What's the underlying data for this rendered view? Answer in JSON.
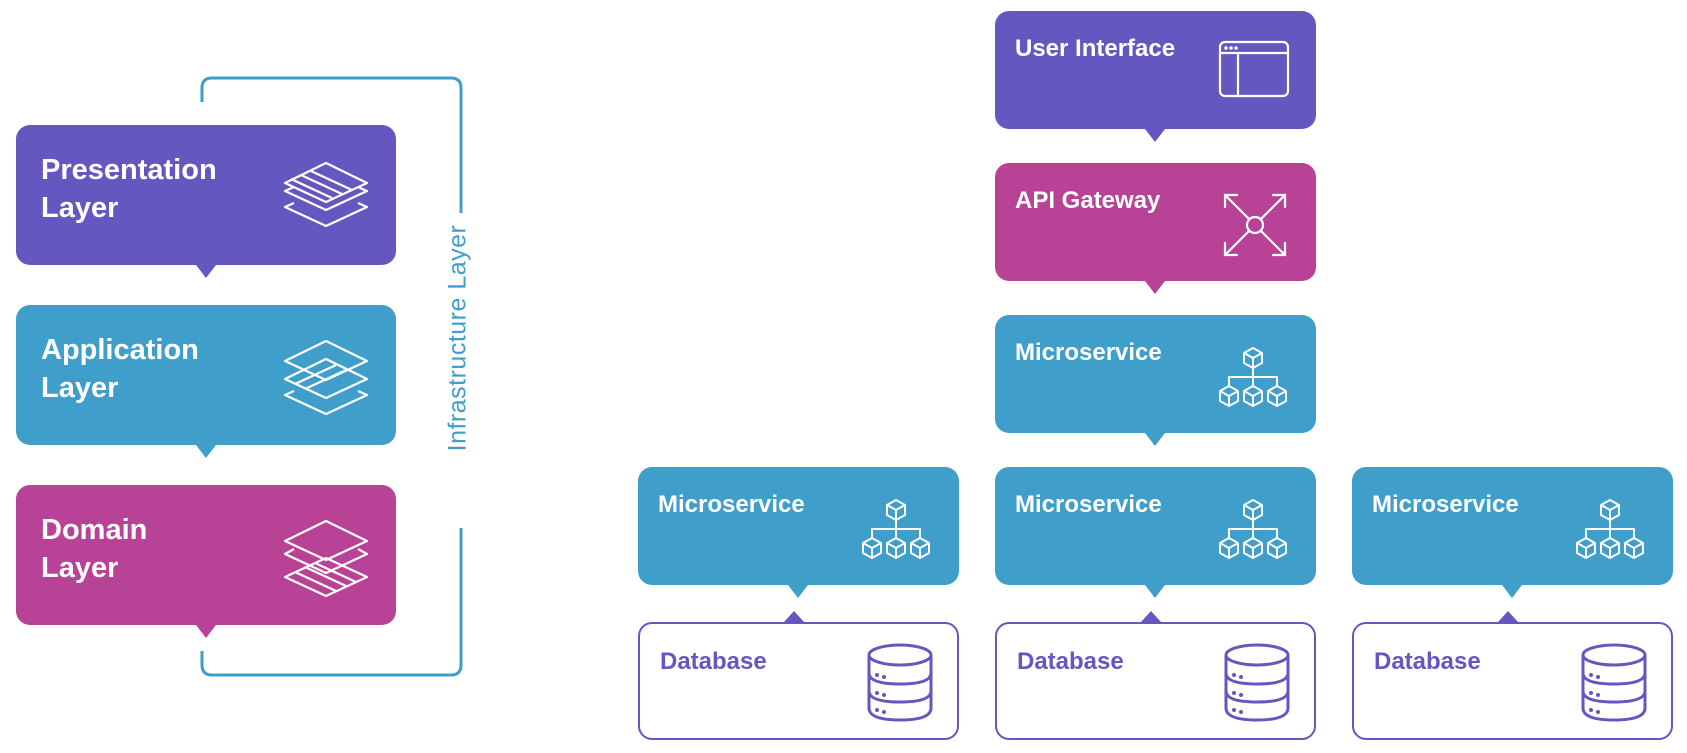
{
  "colors": {
    "presentation": "#6457c0",
    "application": "#3f9fca",
    "domain": "#b84396",
    "infrastructure": "#3f9fca",
    "user_interface": "#6457c0",
    "api_gateway": "#b84396",
    "microservice": "#3f9fca",
    "database_border": "#6457c0"
  },
  "layered": {
    "layers": [
      {
        "label": "Presentation Layer",
        "line1": "Presentation",
        "line2": "Layer",
        "icon": "layers-top-highlight-icon"
      },
      {
        "label": "Application Layer",
        "line1": "Application",
        "line2": "Layer",
        "icon": "layers-middle-highlight-icon"
      },
      {
        "label": "Domain Layer",
        "line1": "Domain",
        "line2": "Layer",
        "icon": "layers-bottom-highlight-icon"
      }
    ],
    "infrastructure_label": "Infrastructure Layer"
  },
  "microservices_arch": {
    "user_interface": {
      "label": "User Interface",
      "icon": "browser-window-icon"
    },
    "api_gateway": {
      "label": "API Gateway",
      "icon": "expand-arrows-hub-icon"
    },
    "central_service": {
      "label": "Microservice",
      "icon": "cube-hierarchy-icon"
    },
    "services": [
      {
        "label": "Microservice",
        "icon": "cube-hierarchy-icon",
        "database": {
          "label": "Database",
          "icon": "database-icon"
        }
      },
      {
        "label": "Microservice",
        "icon": "cube-hierarchy-icon",
        "database": {
          "label": "Database",
          "icon": "database-icon"
        }
      },
      {
        "label": "Microservice",
        "icon": "cube-hierarchy-icon",
        "database": {
          "label": "Database",
          "icon": "database-icon"
        }
      }
    ]
  }
}
